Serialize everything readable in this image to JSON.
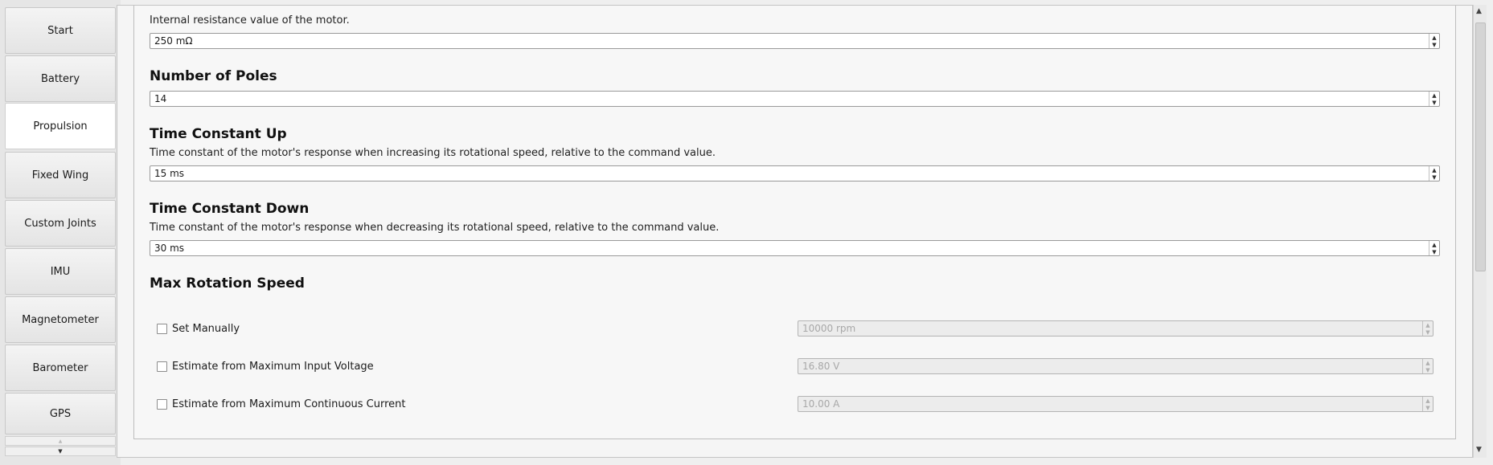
{
  "sidebar": {
    "tabs": [
      {
        "label": "Start",
        "active": false
      },
      {
        "label": "Battery",
        "active": false
      },
      {
        "label": "Propulsion",
        "active": true
      },
      {
        "label": "Fixed Wing",
        "active": false
      },
      {
        "label": "Custom Joints",
        "active": false
      },
      {
        "label": "IMU",
        "active": false
      },
      {
        "label": "Magnetometer",
        "active": false
      },
      {
        "label": "Barometer",
        "active": false
      },
      {
        "label": "GPS",
        "active": false
      }
    ]
  },
  "resistance": {
    "description": "Internal resistance value of the motor.",
    "value": "250 mΩ"
  },
  "poles": {
    "title": "Number of Poles",
    "value": "14"
  },
  "time_up": {
    "title": "Time Constant Up",
    "description": "Time constant of the motor's response when increasing its rotational speed, relative to the command value.",
    "value": "15 ms"
  },
  "time_down": {
    "title": "Time Constant Down",
    "description": "Time constant of the motor's response when decreasing its rotational speed, relative to the command value.",
    "value": "30 ms"
  },
  "max_rotation": {
    "title": "Max Rotation Speed",
    "options": [
      {
        "label": "Set Manually",
        "checked": false,
        "value": "10000 rpm"
      },
      {
        "label": "Estimate from Maximum Input Voltage",
        "checked": false,
        "value": "16.80 V"
      },
      {
        "label": "Estimate from Maximum Continuous Current",
        "checked": false,
        "value": "10.00 A"
      }
    ]
  },
  "icons": {
    "spin_up": "▲",
    "spin_down": "▼",
    "scroll_up": "▲",
    "scroll_down": "▼"
  }
}
